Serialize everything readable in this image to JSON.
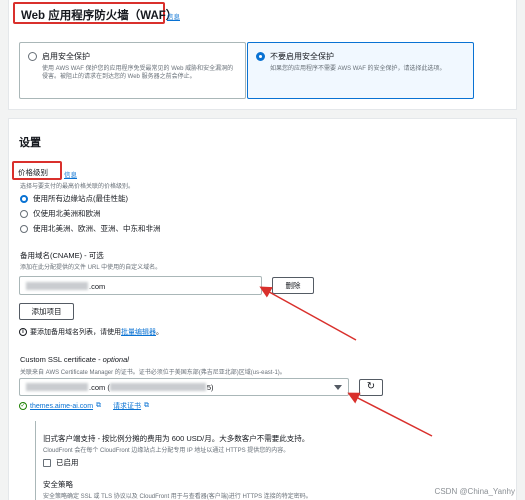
{
  "waf": {
    "title": "Web 应用程序防火墙（WAF）",
    "info": "信息",
    "options": [
      {
        "title": "启用安全保护",
        "desc": "使用 AWS WAF 保护您的应用程序免受最常见的 Web 威胁和安全漏洞的侵害。被阻止的请求在到达您的 Web 服务器之前会停止。"
      },
      {
        "title": "不要启用安全保护",
        "desc": "如果您的应用程序不需要 AWS WAF 的安全保护，请选择此选项。"
      }
    ]
  },
  "settings": {
    "title": "设置",
    "price_class": {
      "label": "价格级别",
      "info": "信息",
      "desc": "选择与要支付的最高价格关联的价格级别。",
      "options": [
        "使用所有边缘站点(最佳性能)",
        "仅使用北美洲和欧洲",
        "使用北美洲、欧洲、亚洲、中东和非洲"
      ]
    },
    "cname": {
      "label": "备用域名(CNAME) - 可选",
      "desc": "添加在此分配提供的文件 URL 中使用的自定义域名。",
      "value_suffix": ".com",
      "remove": "删除",
      "add": "添加项目",
      "bulk_prefix": "要添加备用域名列表，请使用",
      "bulk_link": "批量编辑器",
      "bulk_suffix": "。"
    },
    "ssl": {
      "label": "Custom SSL certificate",
      "optional": "optional",
      "desc": "关联来自 AWS Certificate Manager 的证书。证书必须位于美国东部(弗吉尼亚北部)区域(us-east-1)。",
      "value_mid": ".com (",
      "value_end": "5)",
      "cert_name": "themes.aime-ai.com",
      "request": "请求证书"
    },
    "legacy": {
      "title": "旧式客户端支持 - 按比例分摊的费用为 600 USD/月。大多数客户不需要此支持。",
      "desc": "CloudFront 会在每个 CloudFront 边缘站点上分配专用 IP 地址以通过 HTTPS 提供您的内容。",
      "enabled": "已启用"
    },
    "policy": {
      "title": "安全策略",
      "desc": "安全策略确定 SSL 或 TLS 协议以及 CloudFront 用于与查看器(客户端)进行 HTTPS 连接的特定密码。"
    }
  },
  "watermark": "CSDN @China_Yanhy",
  "colors": {
    "accent": "#0972d3",
    "highlight": "#d9302c",
    "success": "#1d8102"
  }
}
